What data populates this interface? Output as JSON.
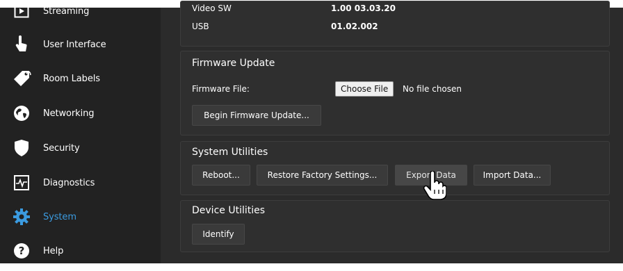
{
  "sidebar": {
    "items": [
      {
        "label": "Streaming",
        "icon": "play-icon"
      },
      {
        "label": "User Interface",
        "icon": "hand-pointer-icon"
      },
      {
        "label": "Room Labels",
        "icon": "tag-icon"
      },
      {
        "label": "Networking",
        "icon": "globe-icon"
      },
      {
        "label": "Security",
        "icon": "shield-icon"
      },
      {
        "label": "Diagnostics",
        "icon": "pulse-icon"
      },
      {
        "label": "System",
        "icon": "gear-icon",
        "active": true
      },
      {
        "label": "Help",
        "icon": "question-icon"
      }
    ]
  },
  "versions": {
    "video_sw_label": "Video SW",
    "video_sw_value": "1.00 03.03.20",
    "usb_label": "USB",
    "usb_value": "01.02.002"
  },
  "firmware": {
    "title": "Firmware Update",
    "file_label": "Firmware File:",
    "choose_file": "Choose File",
    "no_file": "No file chosen",
    "begin_button": "Begin Firmware Update..."
  },
  "system_utilities": {
    "title": "System Utilities",
    "reboot": "Reboot...",
    "restore": "Restore Factory Settings...",
    "export": "Export Data",
    "import": "Import Data..."
  },
  "device_utilities": {
    "title": "Device Utilities",
    "identify": "Identify"
  },
  "colors": {
    "active": "#3b9be0",
    "sidebar_bg": "#222222",
    "main_bg": "#2b2b2b"
  }
}
